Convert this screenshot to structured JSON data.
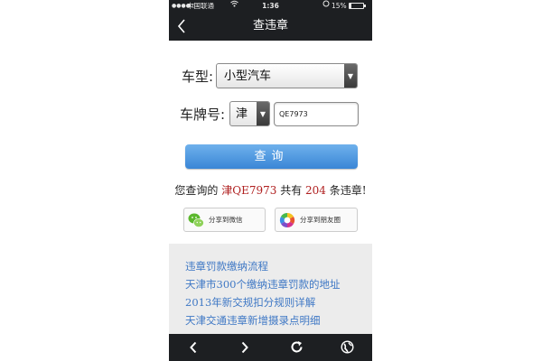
{
  "status_bar": {
    "signal": "●●●●○",
    "carrier": "中国联通",
    "time": "1:36",
    "battery_text": "15%",
    "battery_level": 0.15
  },
  "nav": {
    "title": "查违章",
    "back_icon": "chevron-left-icon"
  },
  "form": {
    "car_type_label": "车型:",
    "car_type_value": "小型汽车",
    "plate_label": "车牌号:",
    "plate_prefix": "津",
    "plate_value": "QE7973"
  },
  "query_button": "查询",
  "result": {
    "prefix": "您查询的 ",
    "plate": "津QE7973",
    "middle": " 共有 ",
    "count": "204",
    "suffix": " 条违章!"
  },
  "share": {
    "wechat_label": "分享到微信",
    "moments_label": "分享到朋友圈"
  },
  "links": [
    "违章罚款缴纳流程",
    "天津市300个缴纳违章罚款的地址",
    "2013年新交规扣分规则详解",
    "天津交通违章新增摄录点明细"
  ],
  "toolbar": {
    "back_icon": "chevron-left-icon",
    "forward_icon": "chevron-right-icon",
    "refresh_icon": "refresh-icon",
    "globe_icon": "globe-icon"
  },
  "colors": {
    "bar_background": "#1d1f22",
    "accent_blue": "#3a86d6",
    "link_blue": "#3f78c5",
    "highlight_red": "#b02020"
  }
}
